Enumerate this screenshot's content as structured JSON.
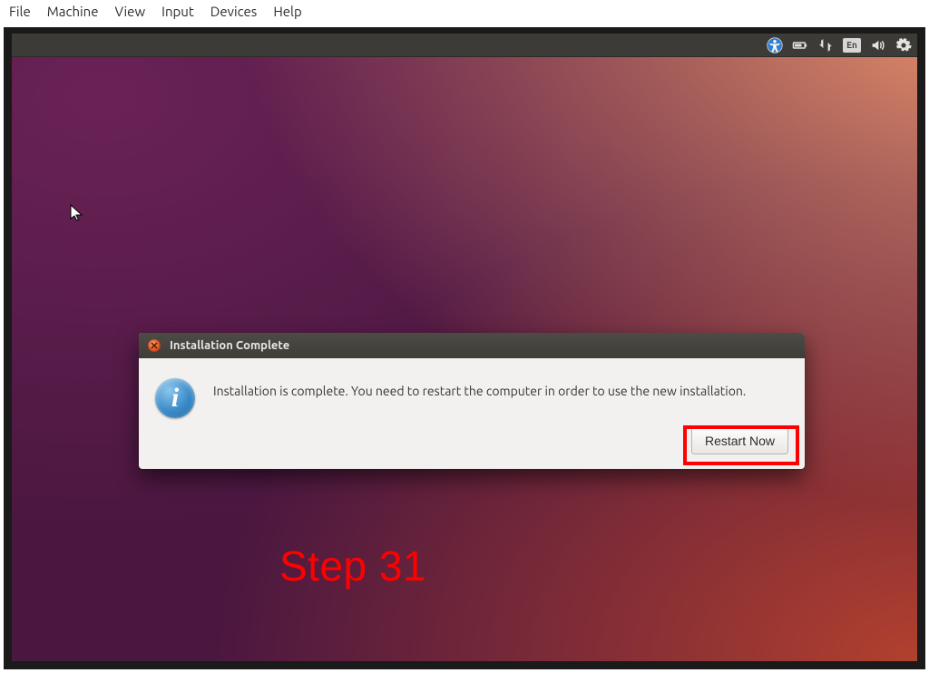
{
  "host_menu": {
    "file": "File",
    "machine": "Machine",
    "view": "View",
    "input": "Input",
    "devices": "Devices",
    "help": "Help"
  },
  "panel": {
    "language_indicator": "En"
  },
  "dialog": {
    "title": "Installation Complete",
    "info_glyph": "i",
    "message": "Installation is complete. You need to restart the computer in order to use the new installation.",
    "restart_button": "Restart Now"
  },
  "annotation": {
    "step_label": "Step 31"
  }
}
